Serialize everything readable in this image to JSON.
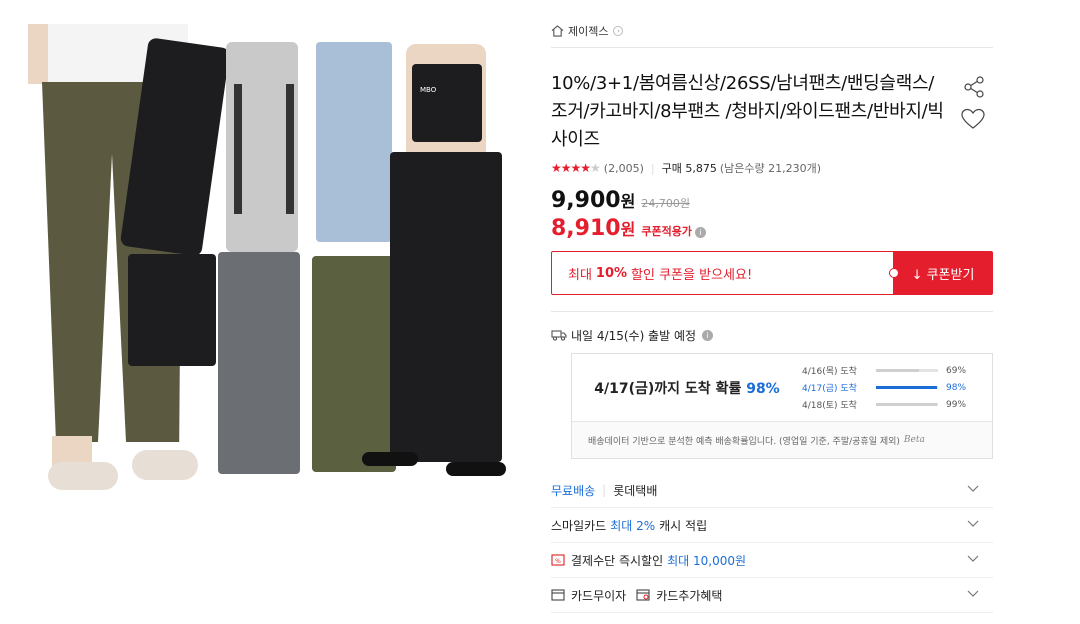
{
  "shop": {
    "name": "제이젝스",
    "arrow": "›"
  },
  "product": {
    "title": "10%/3+1/봄여름신상/26SS/남녀팬츠/밴딩슬랙스/조거/카고바지/8부팬츠 /청바지/와이드팬츠/반바지/빅사이즈",
    "image_label": "MBO"
  },
  "rating": {
    "stars_filled": "★★★★",
    "stars_half": "★",
    "stars_out_of": 5,
    "review_count": "(2,005)",
    "purchase_label": "구매 5,875",
    "stock_label": "(남은수량 21,230개)"
  },
  "price": {
    "sale": "9,900",
    "original": "24,700원",
    "coupon": "8,910",
    "currency": "원",
    "coupon_applied_label": "쿠폰적용가",
    "info_mark": "i"
  },
  "coupon": {
    "prefix": "최대",
    "percent": "10%",
    "suffix": "할인 쿠폰을 받으세요!",
    "button_label": "↓ 쿠폰받기"
  },
  "shipping": {
    "label": "내일 4/15(수) 출발 예정",
    "info_mark": "i",
    "eta_headline_pre": "4/17(금)까지 도착 확률",
    "eta_headline_pct": "98%",
    "eta_items": [
      {
        "date": "4/16(목) 도착",
        "value": "69%",
        "ratio": 0.69,
        "highlight": false
      },
      {
        "date": "4/17(금) 도착",
        "value": "98%",
        "ratio": 0.98,
        "highlight": true
      },
      {
        "date": "4/18(토) 도착",
        "value": "99%",
        "ratio": 0.99,
        "highlight": false
      }
    ],
    "eta_note": "배송데이터 기반으로 분석한 예측 배송확률입니다. (영업일 기준, 주말/공휴일 제외)",
    "beta": "Beta"
  },
  "options": {
    "delivery_free": "무료배송",
    "delivery_carrier": "롯데택배",
    "smile_pre": "스마일카드",
    "smile_highlight": "최대 2%",
    "smile_post": "캐시 적립",
    "pay_pre": "결제수단 즉시할인",
    "pay_highlight": "최대 10,000원",
    "card_installment": "카드무이자",
    "card_benefit": "카드추가혜택"
  },
  "colors": {
    "accent_red": "#e41e2d",
    "accent_blue": "#1b6ed8"
  }
}
